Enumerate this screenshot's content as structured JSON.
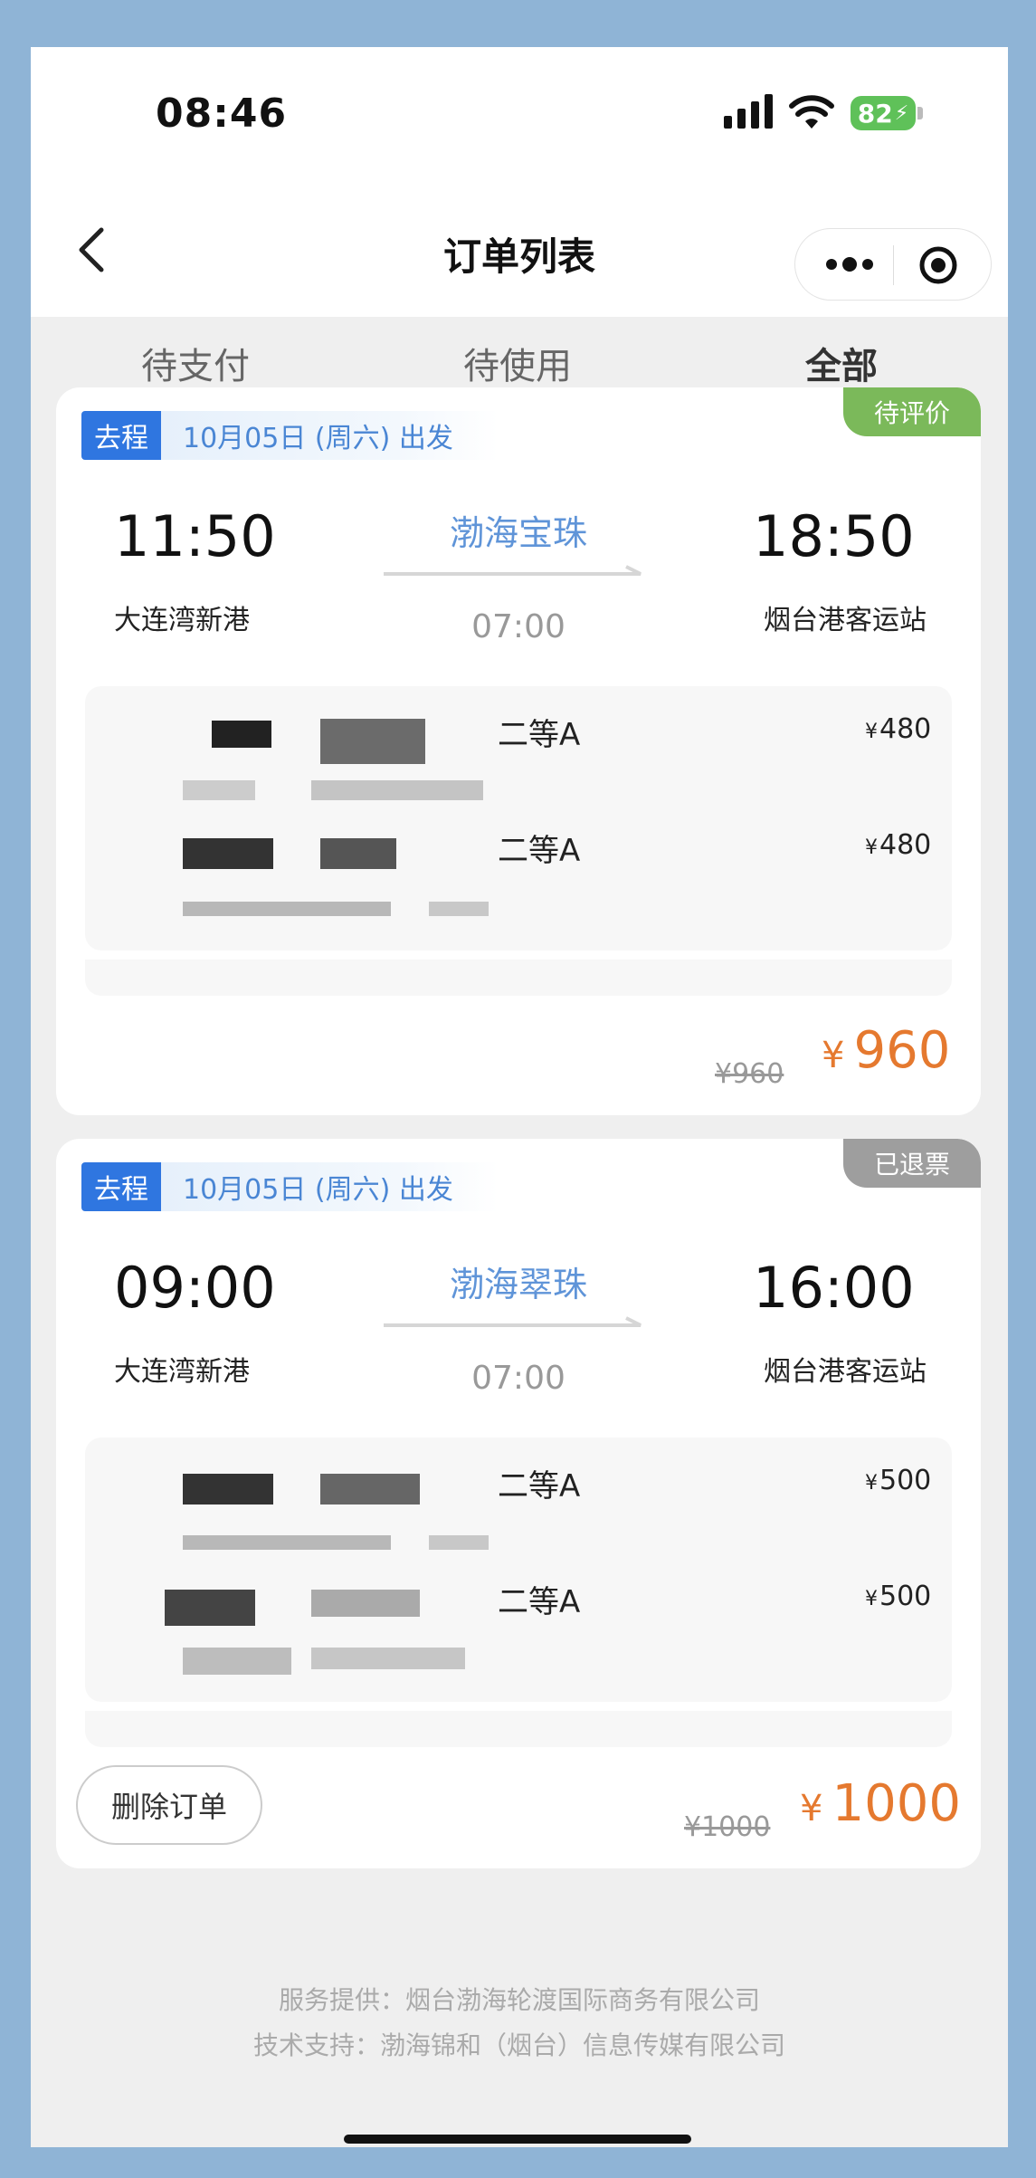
{
  "status_bar": {
    "time": "08:46",
    "battery": "82"
  },
  "nav": {
    "title": "订单列表"
  },
  "tabs": [
    "待支付",
    "待使用",
    "全部"
  ],
  "active_tab": "全部",
  "orders": [
    {
      "status": "待评价",
      "status_color": "#7bb95a",
      "direction": "去程",
      "date": "10月05日 (周六) 出发",
      "depart_time": "11:50",
      "depart_port": "大连湾新港",
      "ship": "渤海宝珠",
      "duration": "07:00",
      "arrive_time": "18:50",
      "arrive_port": "烟台港客运站",
      "passengers": [
        {
          "seat_class": "二等A",
          "price": "480"
        },
        {
          "seat_class": "二等A",
          "price": "480"
        }
      ],
      "original_total": "¥960",
      "total": "960"
    },
    {
      "status": "已退票",
      "status_color": "#9e9e9e",
      "direction": "去程",
      "date": "10月05日 (周六) 出发",
      "depart_time": "09:00",
      "depart_port": "大连湾新港",
      "ship": "渤海翠珠",
      "duration": "07:00",
      "arrive_time": "16:00",
      "arrive_port": "烟台港客运站",
      "passengers": [
        {
          "seat_class": "二等A",
          "price": "500"
        },
        {
          "seat_class": "二等A",
          "price": "500"
        }
      ],
      "original_total": "¥1000",
      "total": "1000",
      "delete_label": "删除订单"
    }
  ],
  "currency_symbol": "¥",
  "footer": {
    "service": "服务提供：烟台渤海轮渡国际商务有限公司",
    "tech": "技术支持：渤海锦和（烟台）信息传媒有限公司"
  }
}
